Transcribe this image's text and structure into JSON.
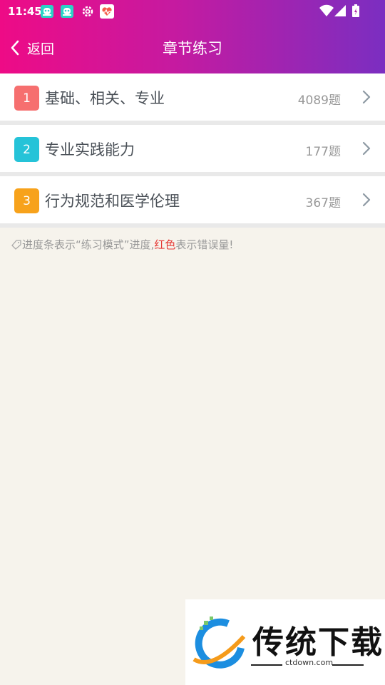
{
  "status_bar": {
    "time": "11:45"
  },
  "navbar": {
    "back_label": "返回",
    "title": "章节练习"
  },
  "chapters": [
    {
      "index": "1",
      "title": "基础、相关、专业",
      "count": "4089题",
      "badge_color": "#f66f6f"
    },
    {
      "index": "2",
      "title": "专业实践能力",
      "count": "177题",
      "badge_color": "#25c3d8"
    },
    {
      "index": "3",
      "title": "行为规范和医学伦理",
      "count": "367题",
      "badge_color": "#f7a21b"
    }
  ],
  "note": {
    "prefix": "进度条表示“练习模式”进度,",
    "highlight": "红色",
    "suffix": "表示错误量!"
  },
  "watermark": {
    "brand": "传统下载",
    "url": "ctdown.com"
  },
  "colors": {
    "gradient_start": "#ee0b86",
    "gradient_end": "#7b2ec1",
    "red": "#e53935"
  }
}
